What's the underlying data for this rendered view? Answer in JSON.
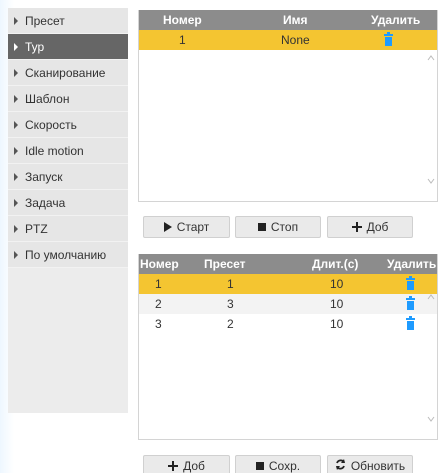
{
  "sidebar": {
    "items": [
      {
        "label": "Пресет"
      },
      {
        "label": "Тур"
      },
      {
        "label": "Сканирование"
      },
      {
        "label": "Шаблон"
      },
      {
        "label": "Скорость"
      },
      {
        "label": "Idle motion"
      },
      {
        "label": "Запуск"
      },
      {
        "label": "Задача"
      },
      {
        "label": "PTZ"
      },
      {
        "label": "По умолчанию"
      }
    ],
    "active_index": 1
  },
  "tour_table": {
    "headers": {
      "number": "Номер",
      "name": "Имя",
      "delete": "Удалить"
    },
    "rows": [
      {
        "number": "1",
        "name": "None",
        "selected": true
      }
    ]
  },
  "tour_buttons": {
    "start": "Старт",
    "stop": "Стоп",
    "add": "Доб"
  },
  "preset_table": {
    "headers": {
      "number": "Номер",
      "preset": "Пресет",
      "duration": "Длит.(с)",
      "delete": "Удалить"
    },
    "rows": [
      {
        "number": "1",
        "preset": "1",
        "duration": "10",
        "selected": true
      },
      {
        "number": "2",
        "preset": "3",
        "duration": "10",
        "selected": false
      },
      {
        "number": "3",
        "preset": "2",
        "duration": "10",
        "selected": false
      }
    ]
  },
  "bottom_buttons": {
    "add": "Доб",
    "save": "Сохр.",
    "refresh": "Обновить"
  },
  "colors": {
    "header": "#8c8c8c",
    "selected_row": "#f4c531",
    "active_sidebar": "#666666",
    "icon_blue": "#1e9bff"
  }
}
